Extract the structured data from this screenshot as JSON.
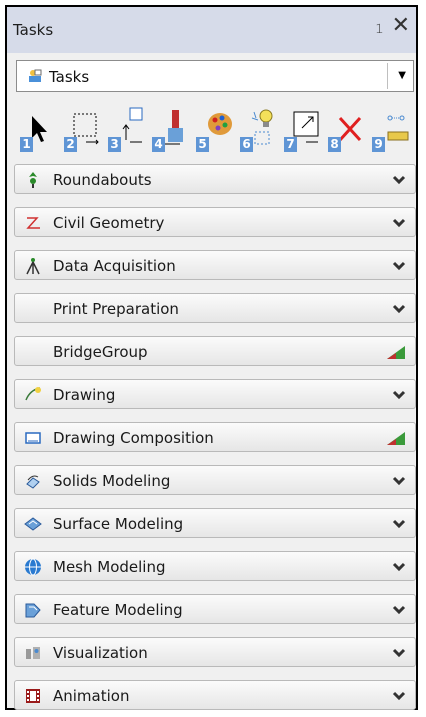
{
  "window": {
    "title": "Tasks"
  },
  "dropdown": {
    "value": "Tasks"
  },
  "toolbar": {
    "tools": [
      {
        "num": "1",
        "icon": "select-arrow-icon"
      },
      {
        "num": "2",
        "icon": "marquee-select-icon"
      },
      {
        "num": "3",
        "icon": "move-icon"
      },
      {
        "num": "4",
        "icon": "paint-brush-icon"
      },
      {
        "num": "5",
        "icon": "palette-icon"
      },
      {
        "num": "6",
        "icon": "lightbulb-icon"
      },
      {
        "num": "7",
        "icon": "scale-icon"
      },
      {
        "num": "8",
        "icon": "delete-icon"
      },
      {
        "num": "9",
        "icon": "measure-icon"
      }
    ]
  },
  "groups": [
    {
      "label": "Roundabouts",
      "icon": "roundabout-icon"
    },
    {
      "label": "Civil Geometry",
      "icon": "civil-geometry-icon"
    },
    {
      "label": "Data Acquisition",
      "icon": "tripod-icon"
    },
    {
      "label": "Print Preparation",
      "icon": ""
    },
    {
      "label": "BridgeGroup",
      "icon": ""
    },
    {
      "label": "Drawing",
      "icon": "drawing-icon"
    },
    {
      "label": "Drawing Composition",
      "icon": "drawing-composition-icon"
    },
    {
      "label": "Solids Modeling",
      "icon": "solids-icon"
    },
    {
      "label": "Surface Modeling",
      "icon": "surface-icon"
    },
    {
      "label": "Mesh Modeling",
      "icon": "mesh-icon"
    },
    {
      "label": "Feature Modeling",
      "icon": "feature-icon"
    },
    {
      "label": "Visualization",
      "icon": "visualization-icon"
    },
    {
      "label": "Animation",
      "icon": "film-icon"
    }
  ]
}
